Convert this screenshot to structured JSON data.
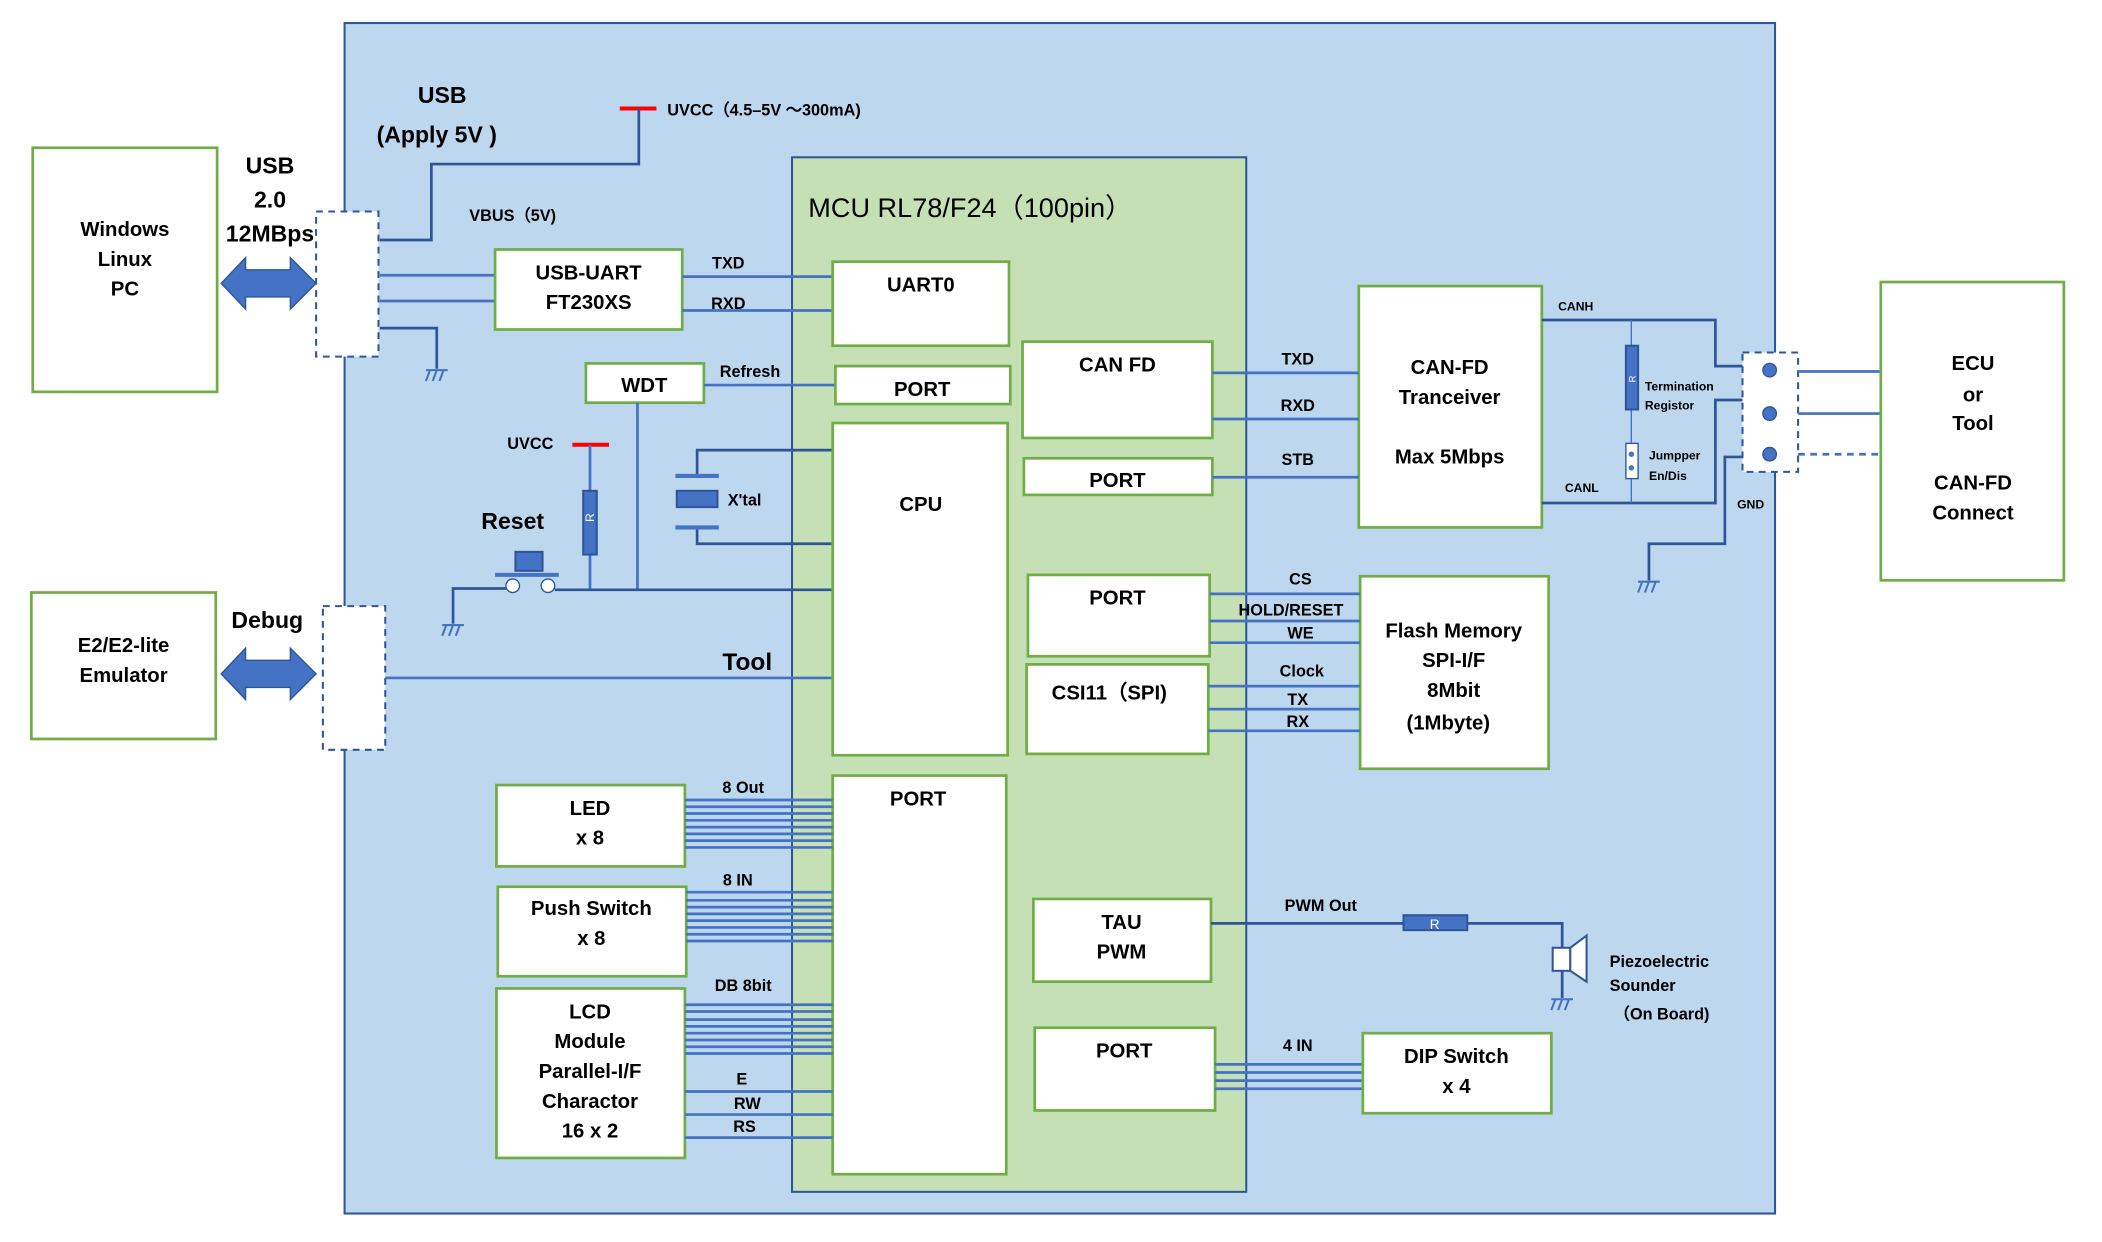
{
  "colors": {
    "board": "#BDD7EE",
    "mcu": "#C5E0B4",
    "box_border": "#70AD47",
    "wire": "#4472C4",
    "border": "#2F5597",
    "power": "#FF0000"
  },
  "host": {
    "lines": [
      "Windows",
      "Linux",
      "PC"
    ]
  },
  "emulator": {
    "lines": [
      "E2/E2-lite",
      "Emulator"
    ]
  },
  "usb_link": {
    "lines": [
      "USB",
      "2.0",
      "12MBps"
    ]
  },
  "debug_label": "Debug",
  "usb_power": {
    "lines": [
      "USB",
      "(Apply 5V )"
    ],
    "uvcc": "UVCC（4.5–5V ～300mA)",
    "vbus": "VBUS（5V)"
  },
  "usb_uart": {
    "lines": [
      "USB-UART",
      "FT230XS"
    ],
    "txd": "TXD",
    "rxd": "RXD"
  },
  "wdt": {
    "label": "WDT",
    "refresh": "Refresh"
  },
  "reset": {
    "uvcc": "UVCC",
    "label": "Reset",
    "resistor": "R"
  },
  "xtal": "X'tal",
  "tool": "Tool",
  "mcu": {
    "title": "MCU RL78/F24（100pin）",
    "uart0": "UART0",
    "port_wdt": "PORT",
    "cpu": "CPU",
    "port_io": "PORT",
    "can_fd": "CAN FD",
    "port_stb": "PORT",
    "port_flash": "PORT",
    "csi": "CSI11（SPI)",
    "tau": [
      "TAU",
      "PWM"
    ],
    "port_dip": "PORT"
  },
  "led": {
    "lines": [
      "LED",
      "x 8"
    ],
    "bus": "8 Out"
  },
  "push": {
    "lines": [
      "Push Switch",
      "x 8"
    ],
    "bus": "8 IN"
  },
  "lcd": {
    "lines": [
      "LCD",
      "Module",
      "Parallel-I/F",
      "Charactor",
      "16 x 2"
    ],
    "bus": "DB 8bit",
    "e": "E",
    "rw": "RW",
    "rs": "RS"
  },
  "can": {
    "lines": [
      "CAN-FD",
      "Tranceiver",
      "Max 5Mbps"
    ],
    "txd": "TXD",
    "rxd": "RXD",
    "stb": "STB",
    "canh": "CANH",
    "canl": "CANL",
    "gnd": "GND",
    "term": [
      "Termination",
      "Registor"
    ],
    "jumper": [
      "Jumpper",
      "En/Dis"
    ],
    "resistor": "R"
  },
  "ecu": {
    "lines": [
      "ECU",
      "or",
      "Tool",
      "CAN-FD",
      "Connect"
    ]
  },
  "flash": {
    "lines": [
      "Flash Memory",
      "SPI-I/F",
      "8Mbit",
      "(1Mbyte)"
    ],
    "cs": "CS",
    "hold": "HOLD/RESET",
    "we": "WE",
    "clock": "Clock",
    "tx": "TX",
    "rx": "RX"
  },
  "pwm": {
    "out": "PWM Out",
    "resistor": "R",
    "sounder": [
      "Piezoelectric",
      "Sounder",
      "（On Board)"
    ]
  },
  "dip": {
    "lines": [
      "DIP Switch",
      "x 4"
    ],
    "bus": "4 IN"
  }
}
